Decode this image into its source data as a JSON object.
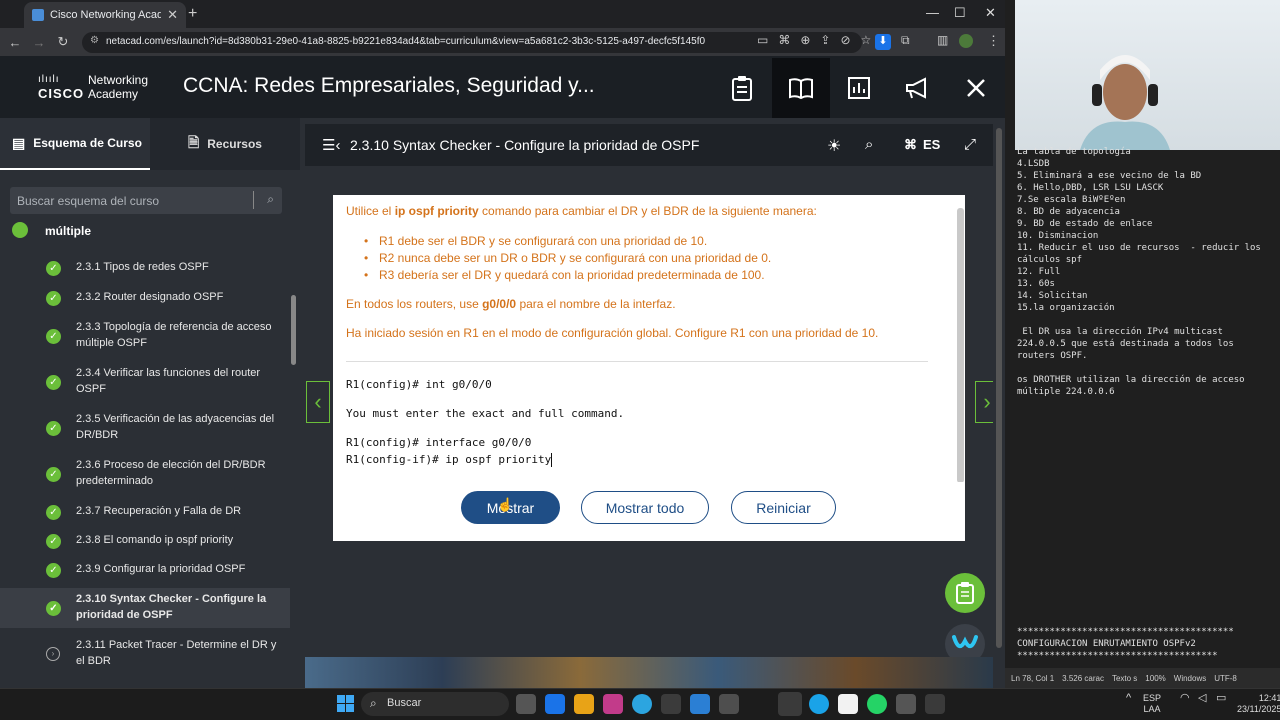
{
  "browser": {
    "tab_title": "Cisco Networking Academy: CC",
    "url": "netacad.com/es/launch?id=8d380b31-29e0-41a8-8825-b9221e834ad4&tab=curriculum&view=a5a681c2-3b3c-5125-a497-decfc5f145f0"
  },
  "header": {
    "brand_line1": "Networking",
    "brand_line2": "Academy",
    "cisco": "CISCO",
    "course_title": "CCNA: Redes Empresariales, Seguridad y..."
  },
  "sidebar": {
    "tab_schema": "Esquema de Curso",
    "tab_resources": "Recursos",
    "search_placeholder": "Buscar esquema del curso",
    "section_title": "múltiple",
    "items": [
      {
        "label": "2.3.1 Tipos de redes OSPF"
      },
      {
        "label": "2.3.2 Router designado OSPF"
      },
      {
        "label": "2.3.3 Topología de referencia de acceso múltiple OSPF"
      },
      {
        "label": "2.3.4 Verificar las funciones del router OSPF"
      },
      {
        "label": "2.3.5 Verificación de las adyacencias del DR/BDR"
      },
      {
        "label": "2.3.6 Proceso de elección del DR/BDR predeterminado"
      },
      {
        "label": "2.3.7 Recuperación y Falla de DR"
      },
      {
        "label": "2.3.8 El comando ip ospf priority"
      },
      {
        "label": "2.3.9 Configurar la prioridad OSPF"
      },
      {
        "label": "2.3.10 Syntax Checker - Configure la prioridad de OSPF"
      },
      {
        "label": "2.3.11 Packet Tracer - Determine el DR y el BDR"
      }
    ]
  },
  "panel": {
    "title": "2.3.10 Syntax Checker - Configure la prioridad de OSPF",
    "lang": "ES",
    "instr_pre": "Utilice el ",
    "instr_cmd": "ip ospf priority",
    "instr_post": " comando para cambiar el DR y el BDR de la siguiente manera:",
    "bullets": [
      "R1 debe ser el BDR y se configurará con una prioridad de 10.",
      "R2 nunca debe ser un DR o BDR y se configurará con una prioridad de 0.",
      "R3 debería ser el DR y quedará con la prioridad predeterminada de 100."
    ],
    "routers_pre": "En todos los routers, use ",
    "routers_iface": "g0/0/0",
    "routers_post": " para el nombre de la interfaz.",
    "login_text": "Ha iniciado sesión en R1 en el modo de configuración global. Configure R1 con una prioridad de 10.",
    "terminal": [
      "R1(config)# int g0/0/0",
      "You must enter the exact and full command.",
      "R1(config)# interface g0/0/0",
      "R1(config-if)# ip ospf priority "
    ],
    "btn_show": "Mostrar",
    "btn_show_all": "Mostrar todo",
    "btn_reset": "Reiniciar"
  },
  "notepad": {
    "lines": [
      "La tabla de topología",
      "4.LSDB",
      "5. Eliminará a ese vecino de la BD",
      "6. Hello,DBD, LSR LSU LASCK",
      "7.Se escala BiWºEºen",
      "8. BD de adyacencia",
      "9. BD de estado de enlace",
      "10. Disminacion",
      "11. Reducir el uso de recursos  - reducir los",
      "cálculos spf",
      "12. Full",
      "13. 60s",
      "14. Solicitan",
      "15.la organización",
      "",
      " El DR usa la dirección IPv4 multicast",
      "224.0.0.5 que está destinada a todos los",
      "routers OSPF.",
      "",
      "os DROTHER utilizan la dirección de acceso",
      "múltiple 224.0.0.6"
    ],
    "footer_lines": [
      "****************************************",
      "CONFIGURACION ENRUTAMIENTO OSPFv2",
      "*************************************"
    ],
    "status_pos": "Ln 78, Col 1",
    "status_chars": "3.526 carac",
    "status_mode": "Texto s",
    "status_zoom": "100%",
    "status_eol": "Windows",
    "status_enc": "UTF-8"
  },
  "taskbar": {
    "search": "Buscar",
    "lang1": "ESP",
    "lang2": "LAA",
    "time": "12:41",
    "date": "23/11/2025"
  },
  "colors": {
    "accent_green": "#6bbf3a",
    "primary_blue": "#1f4e86",
    "instruction_orange": "#d4731b"
  }
}
